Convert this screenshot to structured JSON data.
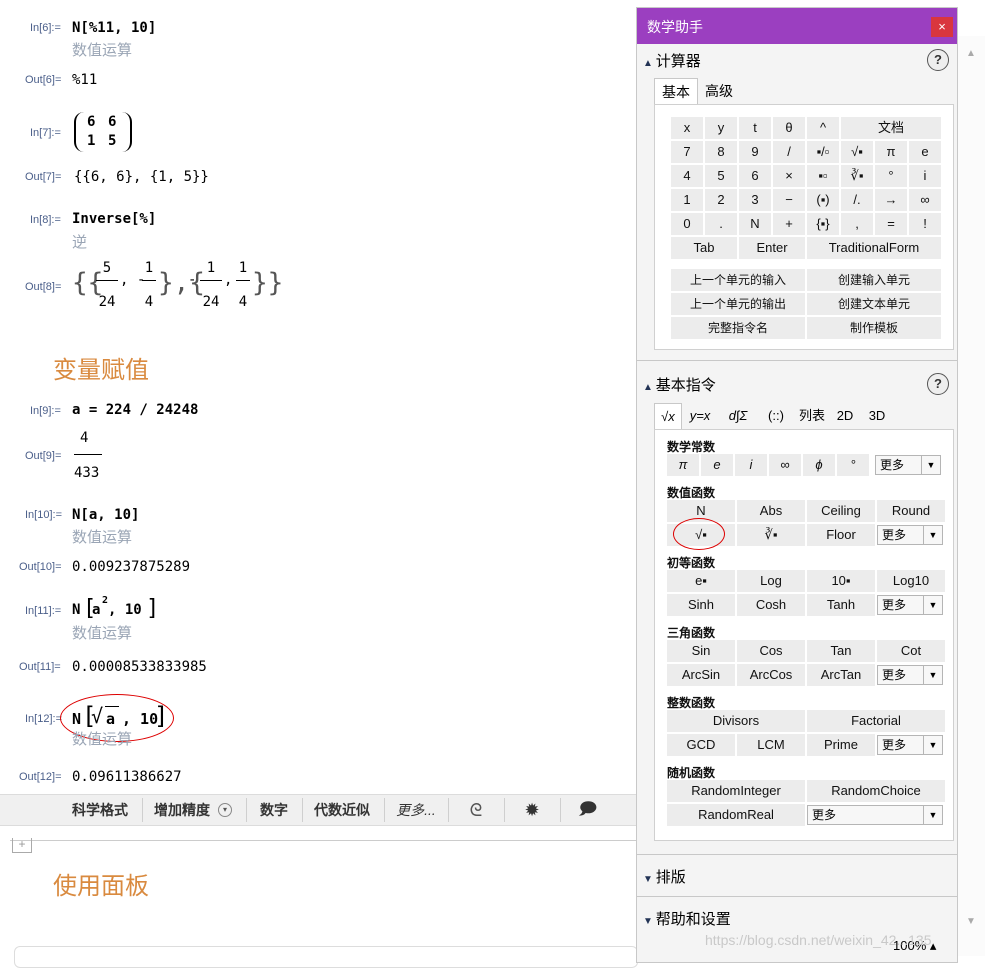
{
  "cells": [
    {
      "in_label": "In[6]:=",
      "input": "N[%11, 10]",
      "hint": "数值运算",
      "out_label": "Out[6]=",
      "output": "%11"
    },
    {
      "in_label": "In[7]:=",
      "matrix": [
        [
          "6",
          "6"
        ],
        [
          "1",
          "5"
        ]
      ],
      "out_label": "Out[7]=",
      "output": "{{6, 6}, {1, 5}}"
    },
    {
      "in_label": "In[8]:=",
      "input": "Inverse[%]",
      "hint": "逆",
      "out_label": "Out[8]=",
      "output_fracs": [
        [
          "5",
          "24"
        ],
        [
          "1",
          "4"
        ],
        [
          "1",
          "24"
        ],
        [
          "1",
          "4"
        ]
      ]
    },
    {
      "in_label": "In[9]:=",
      "input": "a = 224 / 24248",
      "out_label": "Out[9]=",
      "frac_num": "4",
      "frac_den": "433"
    },
    {
      "in_label": "In[10]:=",
      "input": "N[a, 10]",
      "hint": "数值运算",
      "out_label": "Out[10]=",
      "output": "0.009237875289"
    },
    {
      "in_label": "In[11]:=",
      "input_pre": "N",
      "input_base": "a",
      "input_sup": "2",
      "input_post": ", 10",
      "hint": "数值运算",
      "out_label": "Out[11]=",
      "output": "0.00008533833985"
    },
    {
      "in_label": "In[12]:=",
      "input_pre": "N",
      "input_rad": "a",
      "input_post": ", 10",
      "hint": "数值运算",
      "out_label": "Out[12]=",
      "output": "0.09611386627"
    }
  ],
  "section_title": "变量赋值",
  "section_title_2": "使用面板",
  "toolbar": {
    "items": [
      "科学格式",
      "增加精度",
      "数字",
      "代数近似",
      "更多..."
    ]
  },
  "palette": {
    "title": "数学助手",
    "close": "×",
    "calc": {
      "header": "计算器",
      "help": "?",
      "tabs": [
        "基本",
        "高级"
      ],
      "keys_row1": [
        "x",
        "y",
        "t",
        "θ",
        "^",
        "文档"
      ],
      "keys_row2": [
        "7",
        "8",
        "9",
        "/",
        "▪/▫",
        "√▪",
        "π",
        "e"
      ],
      "keys_row3": [
        "4",
        "5",
        "6",
        "×",
        "▪▫",
        "∛▪",
        "°",
        "i"
      ],
      "keys_row4": [
        "1",
        "2",
        "3",
        "−",
        "(▪)",
        "/.",
        "→",
        "∞"
      ],
      "keys_row5": [
        "0",
        ".",
        "N",
        "+",
        "{▪}",
        ",",
        "=",
        "!"
      ],
      "keys_row6": [
        "Tab",
        "Enter",
        "TraditionalForm"
      ],
      "actions": [
        "上一个单元的输入",
        "创建输入单元",
        "上一个单元的输出",
        "创建文本单元",
        "完整指令名",
        "制作模板"
      ]
    },
    "basic": {
      "header": "基本指令",
      "help": "?",
      "tabs": [
        "√x",
        "y=x",
        "d∫Σ",
        "(::)",
        "列表",
        "2D",
        "3D"
      ],
      "groups": [
        {
          "title": "数学常数",
          "row1": [
            "π",
            "e",
            "i",
            "∞",
            "ϕ",
            "°"
          ],
          "more": "更多"
        },
        {
          "title": "数值函数",
          "row1": [
            "N",
            "Abs",
            "Ceiling",
            "Round"
          ],
          "row2": [
            "√▪",
            "∛▪",
            "Floor"
          ],
          "more": "更多"
        },
        {
          "title": "初等函数",
          "row1": [
            "e▪",
            "Log",
            "10▪",
            "Log10"
          ],
          "row2": [
            "Sinh",
            "Cosh",
            "Tanh"
          ],
          "more": "更多"
        },
        {
          "title": "三角函数",
          "row1": [
            "Sin",
            "Cos",
            "Tan",
            "Cot"
          ],
          "row2": [
            "ArcSin",
            "ArcCos",
            "ArcTan"
          ],
          "more": "更多"
        },
        {
          "title": "整数函数",
          "row1": [
            "Divisors",
            "Factorial"
          ],
          "row2": [
            "GCD",
            "LCM",
            "Prime"
          ],
          "more": "更多"
        },
        {
          "title": "随机函数",
          "row1": [
            "RandomInteger",
            "RandomChoice"
          ],
          "row2": [
            "RandomReal"
          ],
          "more": "更多"
        }
      ]
    },
    "typeset": "排版",
    "help_settings": "帮助和设置",
    "zoom": "100%"
  },
  "watermark": "https://blog.csdn.net/weixin_42...135"
}
